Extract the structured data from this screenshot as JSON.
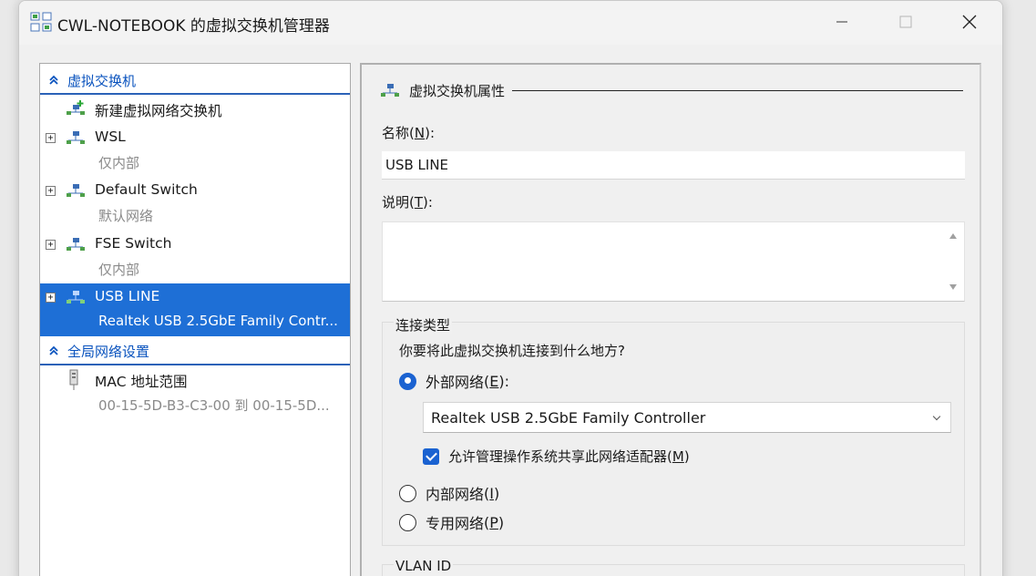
{
  "window": {
    "title": "CWL-NOTEBOOK 的虚拟交换机管理器"
  },
  "tree": {
    "virtual_switches_header": "虚拟交换机",
    "new_switch": "新建虚拟网络交换机",
    "switches": [
      {
        "name": "WSL",
        "detail": "仅内部"
      },
      {
        "name": "Default Switch",
        "detail": "默认网络"
      },
      {
        "name": "FSE Switch",
        "detail": "仅内部"
      },
      {
        "name": "USB LINE",
        "detail": "Realtek USB 2.5GbE Family Contr..."
      }
    ],
    "expander_symbol": "+",
    "global_header": "全局网络设置",
    "mac_range": {
      "name": "MAC 地址范围",
      "detail": "00-15-5D-B3-C3-00 到 00-15-5D..."
    }
  },
  "properties": {
    "header": "虚拟交换机属性",
    "name_label": "名称",
    "name_key": "N",
    "name_value": "USB LINE",
    "desc_label": "说明",
    "desc_key": "T",
    "connection_group": "连接类型",
    "connection_question": "你要将此虚拟交换机连接到什么地方?",
    "external_label": "外部网络",
    "external_key": "E",
    "adapter_selected": "Realtek USB 2.5GbE Family Controller",
    "share_label": "允许管理操作系统共享此网络适配器",
    "share_key": "M",
    "internal_label": "内部网络",
    "internal_key": "I",
    "private_label": "专用网络",
    "private_key": "P",
    "vlan_group": "VLAN ID"
  },
  "colors": {
    "accent": "#1a62d1",
    "selection": "#1e6fd6",
    "header_text": "#0a53be"
  }
}
